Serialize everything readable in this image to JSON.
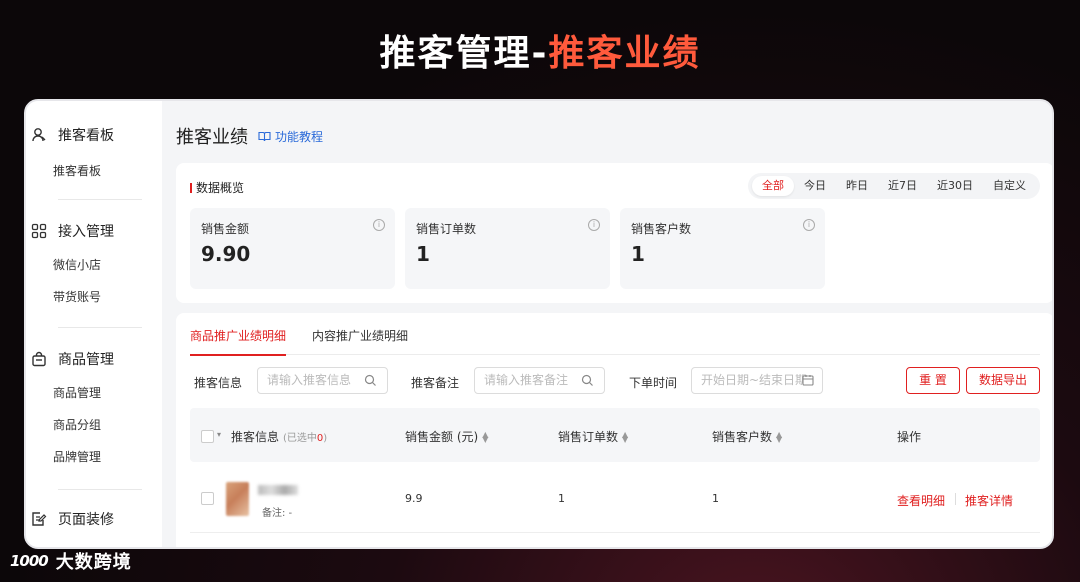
{
  "headline": {
    "part1": "推客管理-",
    "part2": "推客业绩"
  },
  "sidebar": {
    "groups": [
      {
        "title": "推客看板",
        "icon": "user-icon",
        "items": [
          "推客看板"
        ]
      },
      {
        "title": "接入管理",
        "icon": "grid-icon",
        "items": [
          "微信小店",
          "带货账号"
        ]
      },
      {
        "title": "商品管理",
        "icon": "bag-icon",
        "items": [
          "商品管理",
          "商品分组",
          "品牌管理"
        ]
      },
      {
        "title": "页面装修",
        "icon": "edit-icon",
        "items": []
      }
    ]
  },
  "main": {
    "title": "推客业绩",
    "tutorial": "功能教程",
    "overview": {
      "title": "数据概览",
      "filters": [
        "全部",
        "今日",
        "昨日",
        "近7日",
        "近30日",
        "自定义"
      ],
      "active_filter": "全部",
      "metrics": [
        {
          "label": "销售金额",
          "value": "9.90"
        },
        {
          "label": "销售订单数",
          "value": "1"
        },
        {
          "label": "销售客户数",
          "value": "1"
        }
      ]
    },
    "detail": {
      "tabs": [
        "商品推广业绩明细",
        "内容推广业绩明细"
      ],
      "form": {
        "info_label": "推客信息",
        "info_placeholder": "请输入推客信息",
        "remark_label": "推客备注",
        "remark_placeholder": "请输入推客备注",
        "time_label": "下单时间",
        "time_placeholder": "开始日期~结束日期",
        "reset": "重 置",
        "export": "数据导出"
      },
      "table": {
        "headers": {
          "info": "推客信息",
          "selected_prefix": "(已选中",
          "selected_count": "0",
          "selected_suffix": ")",
          "amount": "销售金额 (元)",
          "orders": "销售订单数",
          "customers": "销售客户数",
          "actions": "操作"
        },
        "rows": [
          {
            "note": "备注: -",
            "amount": "9.9",
            "orders": "1",
            "customers": "1",
            "action1": "查看明细",
            "action2": "推客详情"
          }
        ]
      }
    }
  },
  "brand": {
    "mark": "1000",
    "name": "大数跨境"
  }
}
